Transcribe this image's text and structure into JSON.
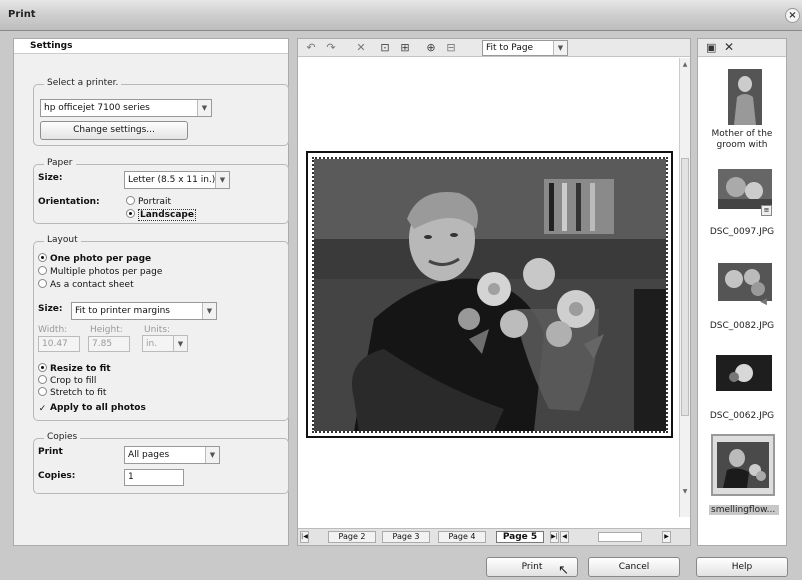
{
  "window": {
    "title": "Print",
    "close_glyph": "×"
  },
  "settings": {
    "header": "Settings",
    "printer": {
      "legend": "Select a printer.",
      "selected": "hp officejet 7100 series",
      "change_button": "Change settings..."
    },
    "paper": {
      "legend": "Paper",
      "size_label": "Size:",
      "size_value": "Letter (8.5 x 11 in.)",
      "orientation_label": "Orientation:",
      "portrait": "Portrait",
      "landscape": "Landscape",
      "selected": "Landscape"
    },
    "layout": {
      "legend": "Layout",
      "opt_one": "One photo per page",
      "opt_multi": "Multiple photos per page",
      "opt_contact": "As a contact sheet",
      "size_label": "Size:",
      "size_value": "Fit to printer margins",
      "width_label": "Width:",
      "width_value": "10.47",
      "height_label": "Height:",
      "height_value": "7.85",
      "units_label": "Units:",
      "units_value": "in.",
      "fit_resize": "Resize to fit",
      "fit_crop": "Crop to fill",
      "fit_stretch": "Stretch to fit",
      "apply_all": "Apply to all photos"
    },
    "copies": {
      "legend": "Copies",
      "print_label": "Print",
      "print_value": "All pages",
      "copies_label": "Copies:",
      "copies_value": "1"
    }
  },
  "preview": {
    "zoom_value": "Fit to Page",
    "pages": [
      "Page 2",
      "Page 3",
      "Page 4",
      "Page 5"
    ],
    "current_page": "Page 5"
  },
  "tray": {
    "items": [
      {
        "caption_line1": "Mother of the",
        "caption_line2": "groom with"
      },
      {
        "caption_line1": "DSC_0097.JPG"
      },
      {
        "caption_line1": "DSC_0082.JPG"
      },
      {
        "caption_line1": "DSC_0062.JPG"
      },
      {
        "caption_line1": "smellingflow..."
      }
    ]
  },
  "footer": {
    "print": "Print",
    "cancel": "Cancel",
    "help": "Help"
  }
}
